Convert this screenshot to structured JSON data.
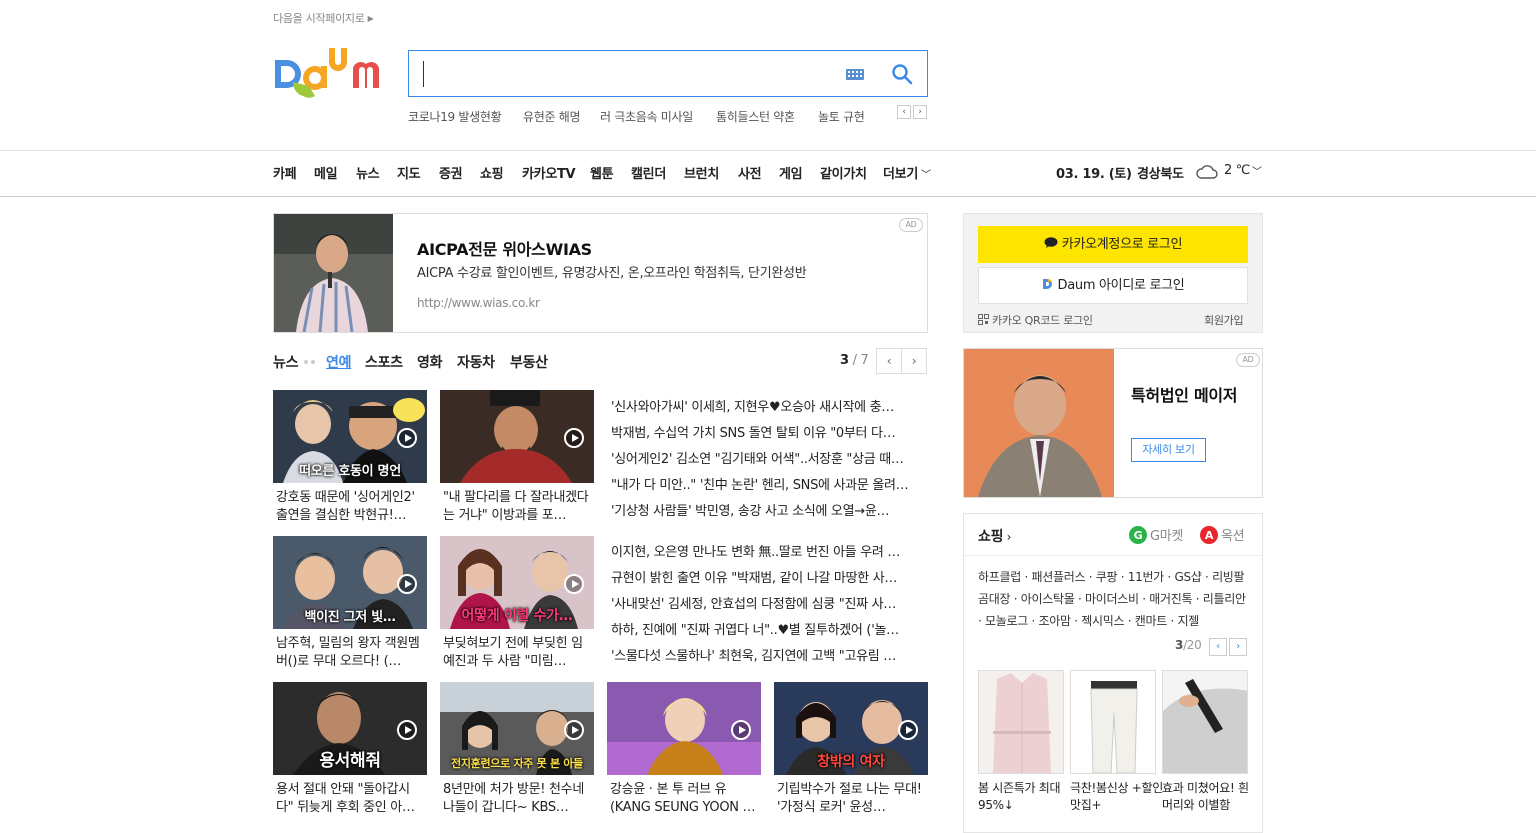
{
  "top": {
    "set_home": "다음을 시작페이지로"
  },
  "logo": {
    "text": "Daum"
  },
  "search": {
    "value": "",
    "realtime_keywords": [
      "코로나19 발생현황",
      "유현준 해명",
      "러 극초음속 미사일",
      "톰히들스턴 약혼",
      "놀토 규현"
    ]
  },
  "gnb": {
    "items": [
      "카페",
      "메일",
      "뉴스",
      "지도",
      "증권",
      "쇼핑",
      "카카오TV",
      "웹툰",
      "캘린더",
      "브런치",
      "사전",
      "게임",
      "같이가치",
      "더보기"
    ]
  },
  "weather": {
    "date": "03. 19. (토)",
    "region": "경상북도",
    "temp": "2 ℃"
  },
  "ad_main": {
    "badge": "AD",
    "title": "AICPA전문 위아스WIAS",
    "desc": "AICPA 수강료 할인이벤트, 유명강사진, 온,오프라인 학점취득, 단기완성반",
    "url": "http://www.wias.co.kr"
  },
  "news": {
    "tabs": [
      "뉴스",
      "연예",
      "스포츠",
      "영화",
      "자동차",
      "부동산"
    ],
    "active_tab": "연예",
    "page_current": "3",
    "page_sep": " / ",
    "page_total": "7",
    "cards": [
      {
        "overlay": "떠오른 호동이 명언",
        "caption": "강호동 때문에 '싱어게인2' 출연을 결심한 박현규!…"
      },
      {
        "overlay": "",
        "caption": "\"내 팔다리를 다 잘라내겠다는 거냐\" 이방과를 포…"
      },
      {
        "overlay": "백이진 그저 빛…",
        "caption": "남주혁, 밀림의 왕자 객원멤버()로 무대 오르다! (…"
      },
      {
        "overlay": "어떻게 이럴 수가…",
        "caption": "부딪혀보기 전에 부딪힌 임예진과 두 사람 \"미림…"
      },
      {
        "overlay": "용서해줘",
        "caption": "용서 절대 안돼 \"돌아갑시다\" 뒤늦게 후회 중인 아…"
      },
      {
        "overlay": "전지훈련으로 자주 못 본 아들",
        "caption": "8년만에 처가 방문! 천수네 나들이 갑니다~ KBS…"
      },
      {
        "overlay": "",
        "caption": "강승윤 · 본 투 러브 유 (KANG SEUNG YOON …"
      },
      {
        "overlay": "창밖의 여자",
        "caption": "기립박수가 절로 나는 무대! '가정식 로커' 윤성…"
      }
    ],
    "headlines_a": [
      "'신사와아가씨' 이세희, 지현우♥오승아 새시작에 충…",
      "박재범, 수십억 가치 SNS 돌연 탈퇴 이유 \"0부터 다…",
      "'싱어게인2' 김소연 \"김기태와 어색\"..서장훈 \"상금 때…",
      "\"내가 다 미안..\" '친中 논란' 헨리, SNS에 사과문 올려…",
      "'기상청 사람들' 박민영, 송강 사고 소식에 오열→윤…"
    ],
    "headlines_b": [
      "이지현, 오은영 만나도 변화 無..딸로 번진 아들 우려 …",
      "규현이 밝힌 출연 이유 \"박재범, 같이 나갈 마땅한 사…",
      "'사내맞선' 김세정, 안효섭의 다정함에 심쿵 \"진짜 사…",
      "하하, 진예에 \"진짜 귀엽다 너\"..♥별 질투하겠어 ('놀…",
      "'스물다섯 스물하나' 최현욱, 김지연에 고백 \"고유림 …"
    ]
  },
  "login": {
    "kakao_label": "카카오계정으로 로그인",
    "daum_brand": "Daum",
    "daum_label": " 아이디로 로그인",
    "qr_label": "카카오 QR코드 로그인",
    "signup_label": "회원가입"
  },
  "ad_side": {
    "badge": "AD",
    "title": "특허법인 메이저",
    "more_label": "자세히 보기"
  },
  "shopping": {
    "title": "쇼핑",
    "gmarket": "G마켓",
    "auction": "옥션",
    "links_text": "하프클럽 · 패션플러스 · 쿠팡 · 11번가 · GS샵 · 리빙팔곰대장 · 아이스탁몰 · 마이더스비 · 매거진톡 · 리틀리안 · 모놀로그 · 조아맘 · 젝시믹스 · 캔마트 · 지젤",
    "page_current": "3",
    "page_total": "/20",
    "products": [
      {
        "caption": "봄 시즌특가 최대 95%↓"
      },
      {
        "caption": "극찬!봄신상 +할인맛집+"
      },
      {
        "caption": "효과 미쳤어요! 흰머리와 이별함"
      }
    ]
  },
  "colors": {
    "accent": "#3c8ae6",
    "kakao": "#fee500"
  }
}
